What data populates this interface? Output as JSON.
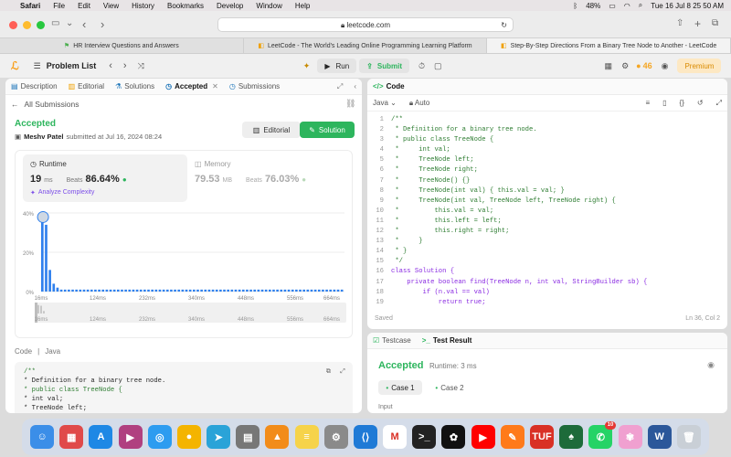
{
  "menubar": {
    "items": [
      "Safari",
      "File",
      "Edit",
      "View",
      "History",
      "Bookmarks",
      "Develop",
      "Window",
      "Help"
    ],
    "battery": "48%",
    "datetime": "Tue 16 Jul  8 25 50 AM"
  },
  "browser": {
    "url": "leetcode.com",
    "tabs": [
      {
        "label": "HR Interview Questions and Answers",
        "active": false
      },
      {
        "label": "LeetCode - The World's Leading Online Programming Learning Platform",
        "active": false
      },
      {
        "label": "Step-By-Step Directions From a Binary Tree Node to Another - LeetCode",
        "active": true
      }
    ]
  },
  "lc_top": {
    "problem_list": "Problem List",
    "run": "Run",
    "submit": "Submit",
    "coins": "46",
    "premium": "Premium"
  },
  "left": {
    "tabs": [
      "Description",
      "Editorial",
      "Solutions",
      "Accepted",
      "Submissions"
    ],
    "all_submissions": "All Submissions",
    "status": "Accepted",
    "user": "Meshv Patel",
    "submitted_at": "submitted at Jul 16, 2024 08:24",
    "editorial_btn": "Editorial",
    "solution_btn": "Solution",
    "runtime": {
      "label": "Runtime",
      "value": "19",
      "unit": "ms",
      "beats_label": "Beats",
      "beats_value": "86.64%",
      "analyze": "Analyze Complexity"
    },
    "memory": {
      "label": "Memory",
      "value": "79.53",
      "unit": "MB",
      "beats_label": "Beats",
      "beats_value": "76.03%"
    },
    "code_label": "Code",
    "lang_label": "Java",
    "code_preview": [
      "/**",
      " * Definition for a binary tree node.",
      " * public class TreeNode {",
      " *     int val;",
      " *     TreeNode left;"
    ]
  },
  "chart_data": {
    "type": "bar",
    "y_ticks": [
      "40%",
      "20%",
      "0%"
    ],
    "ylim": [
      0,
      40
    ],
    "x_ticks": [
      "16ms",
      "124ms",
      "232ms",
      "340ms",
      "448ms",
      "556ms",
      "664ms"
    ],
    "brush_ticks": [
      "16ms",
      "124ms",
      "232ms",
      "340ms",
      "448ms",
      "556ms",
      "664ms"
    ],
    "values": [
      37,
      34,
      11,
      4,
      2,
      1,
      1,
      1,
      1,
      1,
      1,
      1,
      1,
      1,
      1,
      1,
      1,
      1,
      1,
      1,
      1,
      1,
      1,
      1,
      1,
      1,
      1,
      1,
      1,
      1,
      1,
      1,
      1,
      1,
      1,
      1,
      1,
      1,
      1,
      1,
      1,
      1,
      1,
      1,
      1,
      1,
      1,
      1,
      1,
      1,
      1,
      1,
      1,
      1,
      1,
      1,
      1,
      1,
      1,
      1,
      1,
      1,
      1,
      1,
      1,
      1,
      1,
      1,
      1,
      1,
      1,
      1,
      1,
      1,
      1,
      1,
      1,
      1,
      1,
      1
    ],
    "highlight_index": 0,
    "color": "#2f80ed"
  },
  "right": {
    "header": "Code",
    "language": "Java",
    "auto": "Auto",
    "lines": [
      {
        "n": "1",
        "t": "/**",
        "c": "cmt"
      },
      {
        "n": "2",
        "t": " * Definition for a binary tree node.",
        "c": "cmt"
      },
      {
        "n": "3",
        "t": " * public class TreeNode {",
        "c": "cmt"
      },
      {
        "n": "4",
        "t": " *     int val;",
        "c": "cmt"
      },
      {
        "n": "5",
        "t": " *     TreeNode left;",
        "c": "cmt"
      },
      {
        "n": "6",
        "t": " *     TreeNode right;",
        "c": "cmt"
      },
      {
        "n": "7",
        "t": " *     TreeNode() {}",
        "c": "cmt"
      },
      {
        "n": "8",
        "t": " *     TreeNode(int val) { this.val = val; }",
        "c": "cmt"
      },
      {
        "n": "9",
        "t": " *     TreeNode(int val, TreeNode left, TreeNode right) {",
        "c": "cmt"
      },
      {
        "n": "10",
        "t": " *         this.val = val;",
        "c": "cmt"
      },
      {
        "n": "11",
        "t": " *         this.left = left;",
        "c": "cmt"
      },
      {
        "n": "12",
        "t": " *         this.right = right;",
        "c": "cmt"
      },
      {
        "n": "13",
        "t": " *     }",
        "c": "cmt"
      },
      {
        "n": "14",
        "t": " * }",
        "c": "cmt"
      },
      {
        "n": "15",
        "t": " */",
        "c": "cmt"
      },
      {
        "n": "16",
        "t": "class Solution {",
        "c": "code"
      },
      {
        "n": "17",
        "t": "    private boolean find(TreeNode n, int val, StringBuilder sb) {",
        "c": "code"
      },
      {
        "n": "18",
        "t": "        if (n.val == val)",
        "c": "code"
      },
      {
        "n": "19",
        "t": "            return true;",
        "c": "code"
      }
    ],
    "saved": "Saved",
    "position": "Ln 36, Col 2"
  },
  "test": {
    "testcase_tab": "Testcase",
    "result_tab": "Test Result",
    "status": "Accepted",
    "runtime": "Runtime: 3 ms",
    "cases": [
      "Case 1",
      "Case 2"
    ],
    "input_label": "Input"
  },
  "dock": {
    "badge": "10",
    "icons": [
      "finder-icon",
      "launchpad-icon",
      "app-store-icon",
      "screenshot-app-icon",
      "safari-icon",
      "chrome-icon",
      "telegram-icon",
      "calculator-icon",
      "vlc-icon",
      "notes-icon",
      "system-settings-icon",
      "vscode-icon",
      "gmail-icon",
      "terminal-icon",
      "chatgpt-icon",
      "youtube-icon",
      "pencil-app-icon",
      "tuf-icon",
      "mongodb-icon",
      "whatsapp-icon",
      "photos-icon",
      "word-icon",
      "trash-icon"
    ],
    "colors": [
      "#3b8ee8",
      "#e04a4a",
      "#1e88e5",
      "#b04080",
      "#2d9cf0",
      "#f4b400",
      "#2aa3d8",
      "#777777",
      "#f28c1a",
      "#f6d34a",
      "#8a8a8a",
      "#1f7ad6",
      "#ffffff",
      "#222222",
      "#111111",
      "#ff0000",
      "#ff7a1a",
      "#d93025",
      "#1d6b3a",
      "#25d366",
      "#f0a0d0",
      "#2b579a",
      "#c9cfd6"
    ],
    "glyphs": [
      "☺",
      "▦",
      "A",
      "▶",
      "◎",
      "●",
      "➤",
      "▤",
      "▲",
      "≡",
      "⚙",
      "⟨⟩",
      "M",
      ">_",
      "✿",
      "▶",
      "✎",
      "TUF",
      "♠",
      "✆",
      "✾",
      "W",
      "🗑"
    ]
  }
}
